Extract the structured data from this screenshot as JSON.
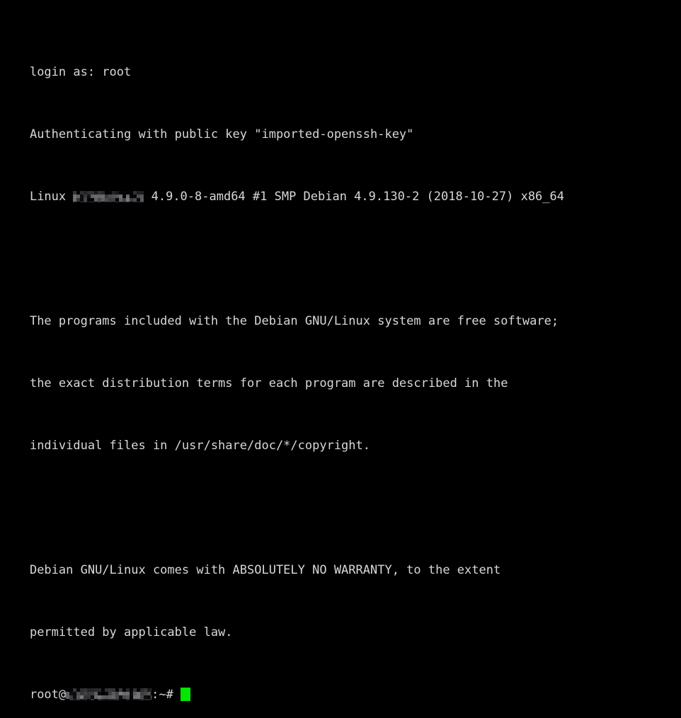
{
  "terminal": {
    "background_color": "#000000",
    "foreground_color": "#d8d8d8",
    "cursor_color": "#00e800",
    "lines": [
      {
        "id": "login-as",
        "text": "login as: root"
      },
      {
        "id": "auth-pubkey",
        "text": "Authenticating with public key \"imported-openssh-key\""
      },
      {
        "id": "uname-prefix",
        "text": "Linux "
      },
      {
        "id": "uname-suffix",
        "text": " 4.9.0-8-amd64 #1 SMP Debian 4.9.130-2 (2018-10-27) x86_64"
      },
      {
        "id": "blank-1",
        "text": ""
      },
      {
        "id": "motd-1",
        "text": "The programs included with the Debian GNU/Linux system are free software;"
      },
      {
        "id": "motd-2",
        "text": "the exact distribution terms for each program are described in the"
      },
      {
        "id": "motd-3",
        "text": "individual files in /usr/share/doc/*/copyright."
      },
      {
        "id": "blank-2",
        "text": ""
      },
      {
        "id": "warranty-1",
        "text": "Debian GNU/Linux comes with ABSOLUTELY NO WARRANTY, to the extent"
      },
      {
        "id": "warranty-2",
        "text": "permitted by applicable law."
      }
    ],
    "prompt": {
      "user": "root@",
      "host_redacted": true,
      "path_and_sigil": ":~#",
      "command": "",
      "cursor": "block"
    },
    "redaction_note": "hostname pixelated"
  }
}
